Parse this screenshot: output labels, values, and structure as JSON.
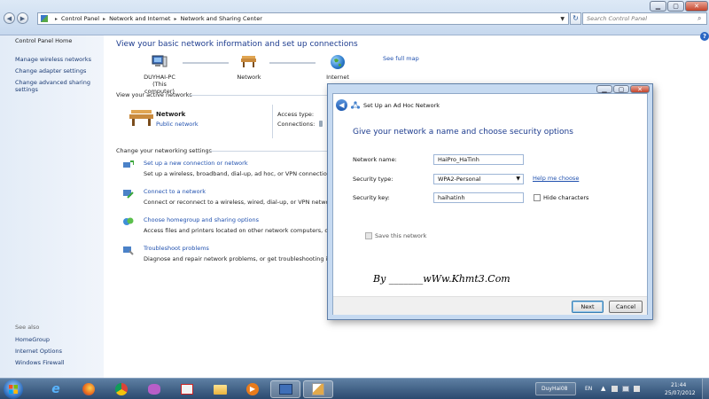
{
  "window": {
    "minimize": "▁",
    "maximize": "▢",
    "close": "✕"
  },
  "address_bar": {
    "crumbs": [
      "Control Panel",
      "Network and Internet",
      "Network and Sharing Center"
    ],
    "search_placeholder": "Search Control Panel"
  },
  "sidebar": {
    "home": "Control Panel Home",
    "links": [
      "Manage wireless networks",
      "Change adapter settings",
      "Change advanced sharing settings"
    ],
    "see_also_heading": "See also",
    "see_also": [
      "HomeGroup",
      "Internet Options",
      "Windows Firewall"
    ]
  },
  "main": {
    "title": "View your basic network information and set up connections",
    "map": {
      "computer_label": "DUYHAI-PC",
      "computer_sub": "(This computer)",
      "network_label": "Network",
      "internet_label": "Internet",
      "see_full_map": "See full map"
    },
    "active_heading": "View your active networks",
    "active_network": {
      "name": "Network",
      "type": "Public network",
      "access_type_label": "Access type:",
      "connections_label": "Connections:"
    },
    "settings_heading": "Change your networking settings",
    "tasks": [
      {
        "title": "Set up a new connection or network",
        "desc": "Set up a wireless, broadband, dial-up, ad hoc, or VPN connection; o"
      },
      {
        "title": "Connect to a network",
        "desc": "Connect or reconnect to a wireless, wired, dial-up, or VPN network"
      },
      {
        "title": "Choose homegroup and sharing options",
        "desc": "Access files and printers located on other network computers, or ch"
      },
      {
        "title": "Troubleshoot problems",
        "desc": "Diagnose and repair network problems, or get troubleshooting info"
      }
    ]
  },
  "dialog": {
    "title": "Set Up an Ad Hoc Network",
    "heading": "Give your network a name and choose security options",
    "network_name_label": "Network name:",
    "network_name_value": "HaiPro_HaTinh",
    "security_type_label": "Security type:",
    "security_type_value": "WPA2-Personal",
    "help_link": "Help me choose",
    "security_key_label": "Security key:",
    "security_key_value": "haihatinh",
    "hide_characters": "Hide characters",
    "save_network": "Save this network",
    "watermark": "By _______wWw.Khmt3.Com",
    "next": "Next",
    "cancel": "Cancel"
  },
  "taskbar": {
    "user_label": "DuyHai08",
    "language": "EN",
    "time": "21:44",
    "date": "25/07/2012"
  },
  "colors": {
    "link": "#1e4fae",
    "heading": "#1e3d8f",
    "taskbar": "#2b4a6f"
  }
}
